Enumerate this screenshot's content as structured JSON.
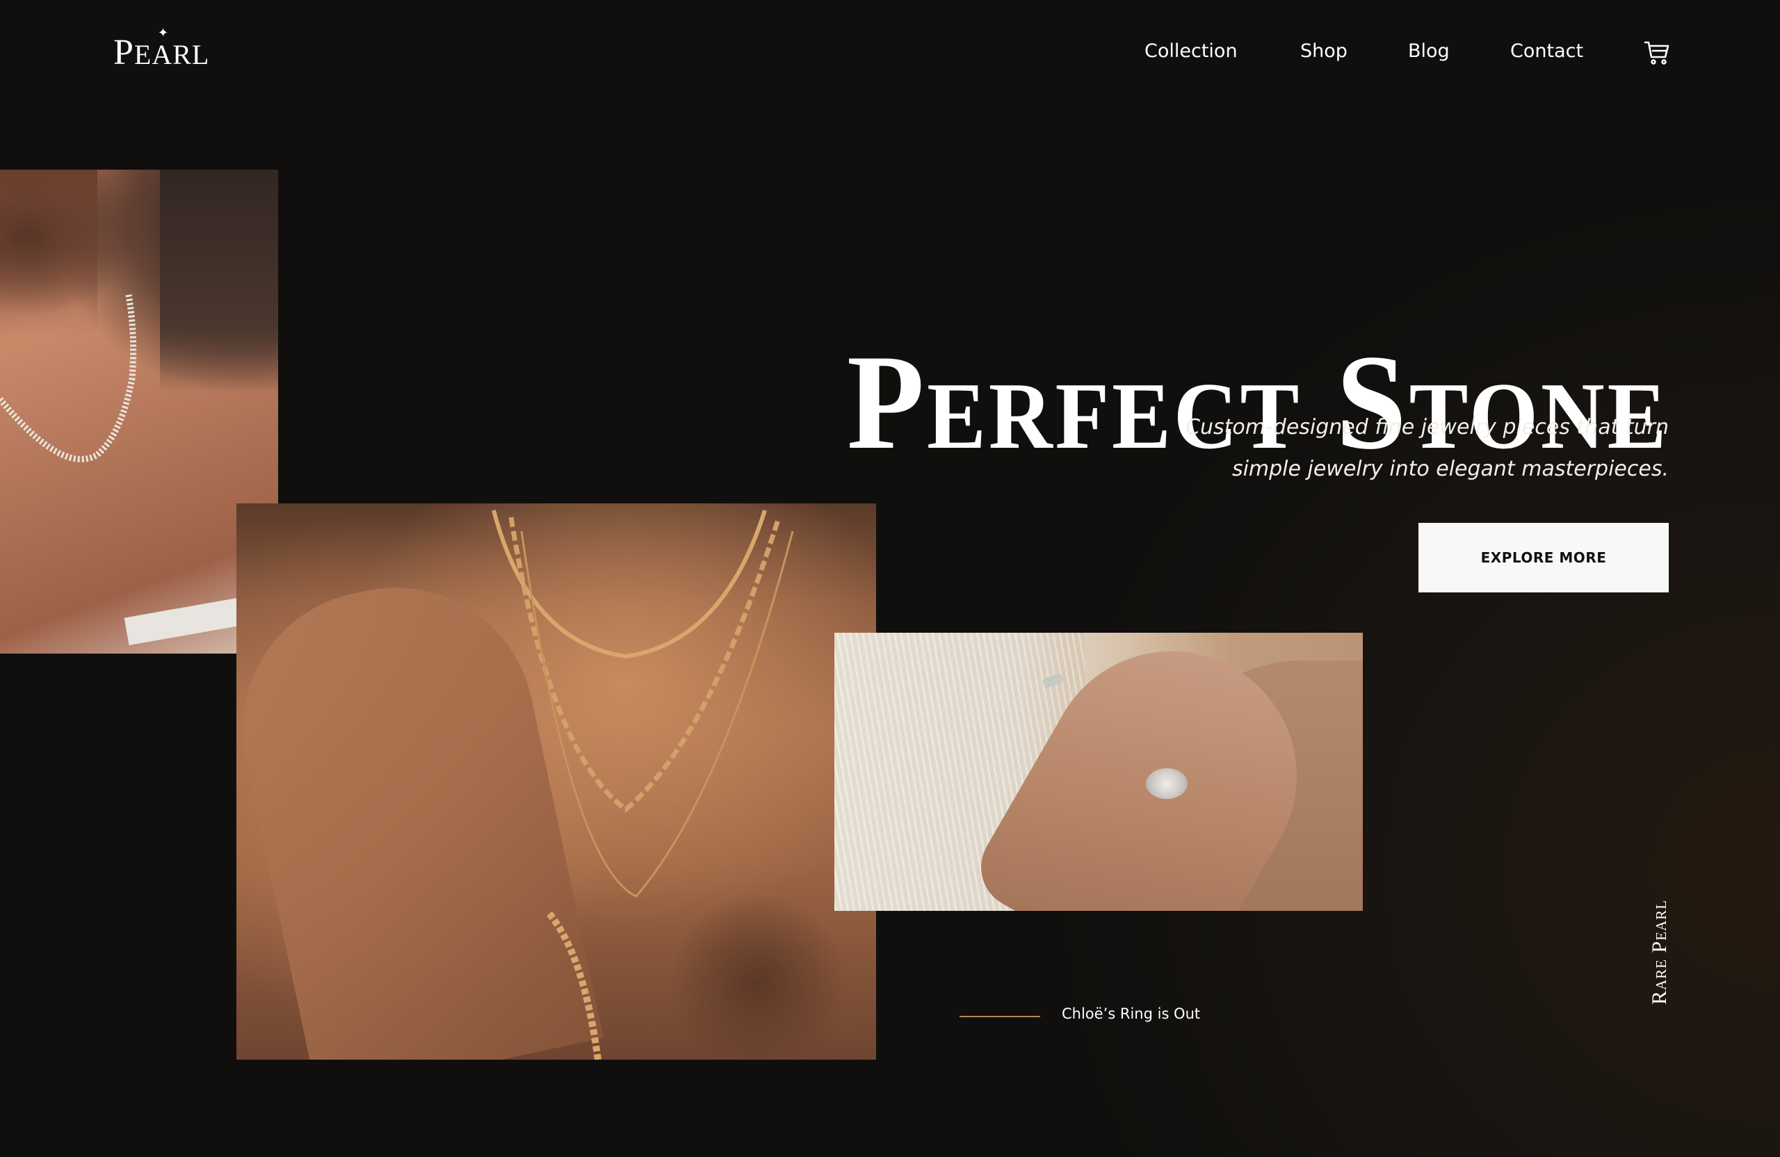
{
  "header": {
    "logo": {
      "first_letter": "P",
      "rest": "EARL"
    },
    "nav": [
      {
        "label": "Collection"
      },
      {
        "label": "Shop"
      },
      {
        "label": "Blog"
      },
      {
        "label": "Contact"
      }
    ],
    "cart_icon": "shopping-cart-icon"
  },
  "hero": {
    "title": "Perfect Stone",
    "subtitle_line1": "Custom-designed fine jewelry pieces that turn",
    "subtitle_line2": "simple jewelry into elegant masterpieces.",
    "cta_label": "EXPLORE MORE"
  },
  "caption": {
    "text": "Chloë’s Ring is Out"
  },
  "side_label": "Rare Pearl",
  "colors": {
    "background": "#100f0d",
    "button_bg": "#f8f8f6",
    "accent_line": "#b58454",
    "text": "#ffffff"
  }
}
